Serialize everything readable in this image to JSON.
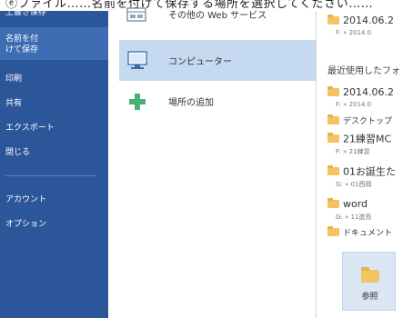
{
  "header": {
    "partial_text": "ⓔファイル……名前を付けて保存する場所を選択してください……"
  },
  "nav": {
    "items": [
      {
        "label": "上書き保存"
      },
      {
        "label": "名前を付けて保存"
      },
      {
        "label": "印刷"
      },
      {
        "label": "共有"
      },
      {
        "label": "エクスポート"
      },
      {
        "label": "閉じる"
      },
      {
        "label": "アカウント"
      },
      {
        "label": "オプション"
      }
    ]
  },
  "places": [
    {
      "label": "その他の Web サービス",
      "icon": "web-services-icon"
    },
    {
      "label": "コンピューター",
      "icon": "computer-icon",
      "selected": true
    },
    {
      "label": "場所の追加",
      "icon": "add-place-icon"
    }
  ],
  "recent": {
    "top_entry": {
      "name": "2014.06.2",
      "path": "F: » 2014.0"
    },
    "header": "最近使用したフォ",
    "folders": [
      {
        "name": "2014.06.2",
        "path": "F: » 2014.0"
      },
      {
        "name": "デスクトップ",
        "path": ""
      },
      {
        "name": "21練習MC",
        "path": "F: » 21練習"
      },
      {
        "name": "01お誕生た",
        "path": "G: » 01西岡"
      },
      {
        "name": "word",
        "path": "G: » 11進島"
      },
      {
        "name": "ドキュメント",
        "path": ""
      }
    ]
  },
  "browse": {
    "label": "参照"
  },
  "colors": {
    "nav_bg": "#2b579a",
    "nav_selected": "#3e6db3",
    "place_selected": "#c5d9f1",
    "folder": "#f2c464"
  }
}
